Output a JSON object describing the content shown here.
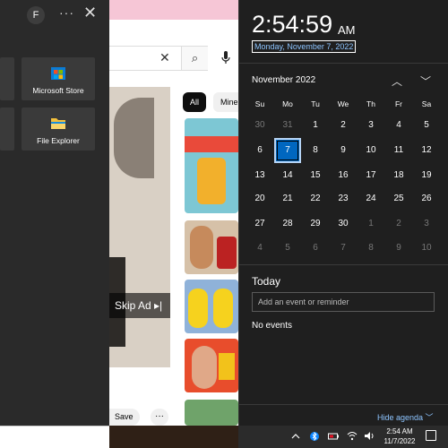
{
  "start_menu": {
    "avatar_initial": "F",
    "more_label": "···",
    "close_label": "✕",
    "tiles": [
      {
        "label": "Microsoft Store",
        "icon": "store-icon"
      },
      {
        "label": "File Explorer",
        "icon": "folder-icon"
      }
    ]
  },
  "browser": {
    "search_clear": "✕",
    "search_icon": "⌕",
    "chips": [
      "All",
      "Mine"
    ],
    "skip_ad_label": "Skip Ad ▸|",
    "save_label": "Save",
    "more_label": "···"
  },
  "flyout": {
    "time": "2:54:59",
    "ampm": "AM",
    "date": "Monday, November 7, 2022",
    "month": "November 2022",
    "nav_up": "︿",
    "nav_down": "﹀",
    "weekdays": [
      "Su",
      "Mo",
      "Tu",
      "We",
      "Th",
      "Fr",
      "Sa"
    ],
    "weeks": [
      [
        "30",
        "31",
        "1",
        "2",
        "3",
        "4",
        "5"
      ],
      [
        "6",
        "7",
        "8",
        "9",
        "10",
        "11",
        "12"
      ],
      [
        "13",
        "14",
        "15",
        "16",
        "17",
        "18",
        "19"
      ],
      [
        "20",
        "21",
        "22",
        "23",
        "24",
        "25",
        "26"
      ],
      [
        "27",
        "28",
        "29",
        "30",
        "1",
        "2",
        "3"
      ],
      [
        "4",
        "5",
        "6",
        "7",
        "8",
        "9",
        "10"
      ]
    ],
    "today_heading": "Today",
    "event_placeholder": "Add an event or reminder",
    "no_events": "No events",
    "hide_agenda": "Hide agenda ﹀"
  },
  "taskbar": {
    "tray_icons": [
      "chevron-up-icon",
      "bluetooth-icon",
      "battery-icon",
      "wifi-icon",
      "volume-icon"
    ],
    "clock_time": "2:54 AM",
    "clock_date": "11/7/2022"
  },
  "colors": {
    "accent": "#0067c0",
    "link": "#8ec5ff"
  }
}
